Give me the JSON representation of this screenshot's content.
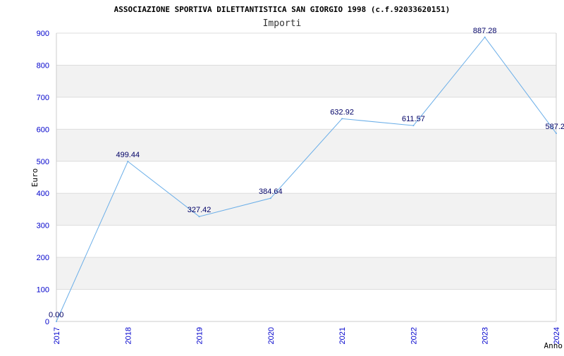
{
  "chart_data": {
    "type": "line",
    "title": "ASSOCIAZIONE SPORTIVA DILETTANTISTICA SAN GIORGIO 1998 (c.f.92033620151)",
    "subtitle": "Importi",
    "xlabel": "Anno",
    "ylabel": "Euro",
    "categories": [
      "2017",
      "2018",
      "2019",
      "2020",
      "2021",
      "2022",
      "2023",
      "2024"
    ],
    "series": [
      {
        "values": [
          0.0,
          499.44,
          327.42,
          384.64,
          632.92,
          611.57,
          887.28,
          587.2
        ],
        "labels": [
          "0.00",
          "499.44",
          "327.42",
          "384.64",
          "632.92",
          "611.57",
          "887.28",
          "587.2"
        ]
      }
    ],
    "ylim": [
      0,
      900
    ],
    "yticks": [
      "0",
      "100",
      "200",
      "300",
      "400",
      "500",
      "600",
      "700",
      "800",
      "900"
    ],
    "grid": true,
    "colors": {
      "line": "#6aaee8",
      "band": "#f2f2f2",
      "grid": "#dddddd",
      "tick_text": "#0000cc",
      "data_label": "#000066"
    }
  }
}
